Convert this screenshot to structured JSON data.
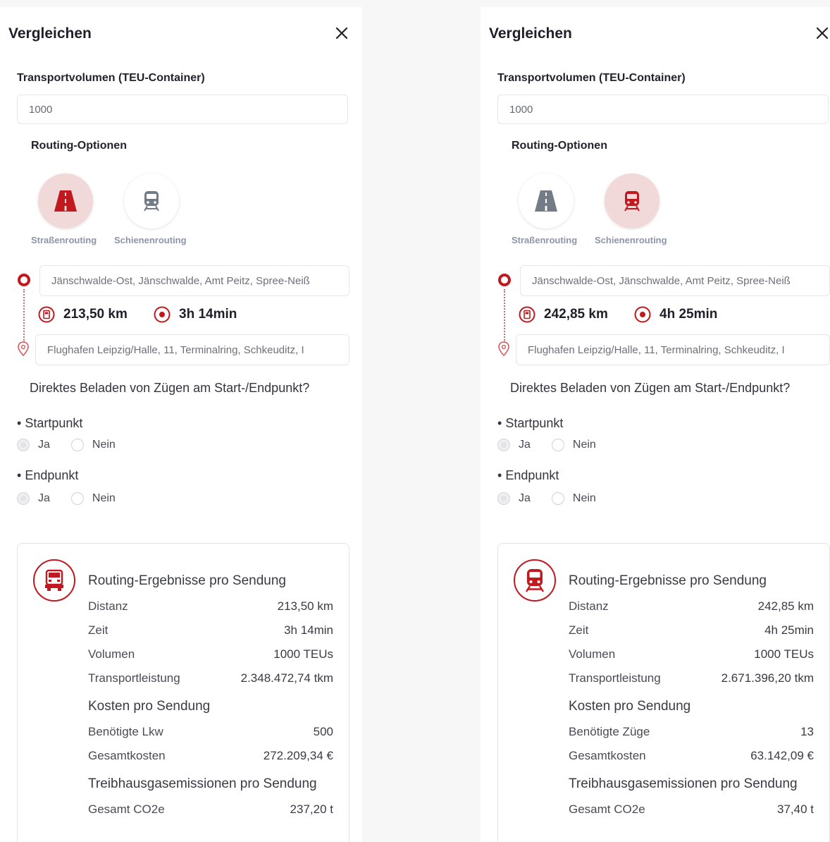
{
  "panels": [
    {
      "title": "Vergleichen",
      "volume_label": "Transportvolumen (TEU-Container)",
      "volume_value": "1000",
      "routing_label": "Routing-Optionen",
      "modes": {
        "road": "Straßenrouting",
        "rail": "Schienenrouting",
        "active": "road"
      },
      "origin": "Jänschwalde-Ost, Jänschwalde, Amt Peitz, Spree-Neiß",
      "destination": "Flughafen Leipzig/Halle, 11, Terminalring, Schkeuditz, I",
      "distance": "213,50 km",
      "time": "3h 14min",
      "question": "Direktes Beladen von Zügen am Start-/Endpunkt?",
      "start_label": "Startpunkt",
      "end_label": "Endpunkt",
      "radio_yes": "Ja",
      "radio_no": "Nein",
      "results": {
        "icon": "truck-icon",
        "title": "Routing-Ergebnisse pro Sendung",
        "rows": [
          {
            "label": "Distanz",
            "value": "213,50 km"
          },
          {
            "label": "Zeit",
            "value": "3h 14min"
          },
          {
            "label": "Volumen",
            "value": "1000 TEUs"
          },
          {
            "label": "Transportleistung",
            "value": "2.348.472,74 tkm"
          }
        ],
        "cost_title": "Kosten pro Sendung",
        "cost_rows": [
          {
            "label": "Benötigte Lkw",
            "value": "500"
          },
          {
            "label": "Gesamtkosten",
            "value": "272.209,34 €"
          }
        ],
        "ghg_title": "Treibhausgasemissionen pro Sendung",
        "ghg_rows": [
          {
            "label": "Gesamt CO2e",
            "value": "237,20 t"
          }
        ]
      }
    },
    {
      "title": "Vergleichen",
      "volume_label": "Transportvolumen (TEU-Container)",
      "volume_value": "1000",
      "routing_label": "Routing-Optionen",
      "modes": {
        "road": "Straßenrouting",
        "rail": "Schienenrouting",
        "active": "rail"
      },
      "origin": "Jänschwalde-Ost, Jänschwalde, Amt Peitz, Spree-Neiß",
      "destination": "Flughafen Leipzig/Halle, 11, Terminalring, Schkeuditz, I",
      "distance": "242,85 km",
      "time": "4h 25min",
      "question": "Direktes Beladen von Zügen am Start-/Endpunkt?",
      "start_label": "Startpunkt",
      "end_label": "Endpunkt",
      "radio_yes": "Ja",
      "radio_no": "Nein",
      "results": {
        "icon": "train-icon",
        "title": "Routing-Ergebnisse pro Sendung",
        "rows": [
          {
            "label": "Distanz",
            "value": "242,85 km"
          },
          {
            "label": "Zeit",
            "value": "4h 25min"
          },
          {
            "label": "Volumen",
            "value": "1000 TEUs"
          },
          {
            "label": "Transportleistung",
            "value": "2.671.396,20 tkm"
          }
        ],
        "cost_title": "Kosten pro Sendung",
        "cost_rows": [
          {
            "label": "Benötigte Züge",
            "value": "13"
          },
          {
            "label": "Gesamtkosten",
            "value": "63.142,09 €"
          }
        ],
        "ghg_title": "Treibhausgasemissionen pro Sendung",
        "ghg_rows": [
          {
            "label": "Gesamt CO2e",
            "value": "37,40 t"
          }
        ]
      }
    }
  ],
  "colors": {
    "accent": "#c0191f",
    "active_bg": "#f2d9d9",
    "muted_label": "#8d95a8"
  }
}
